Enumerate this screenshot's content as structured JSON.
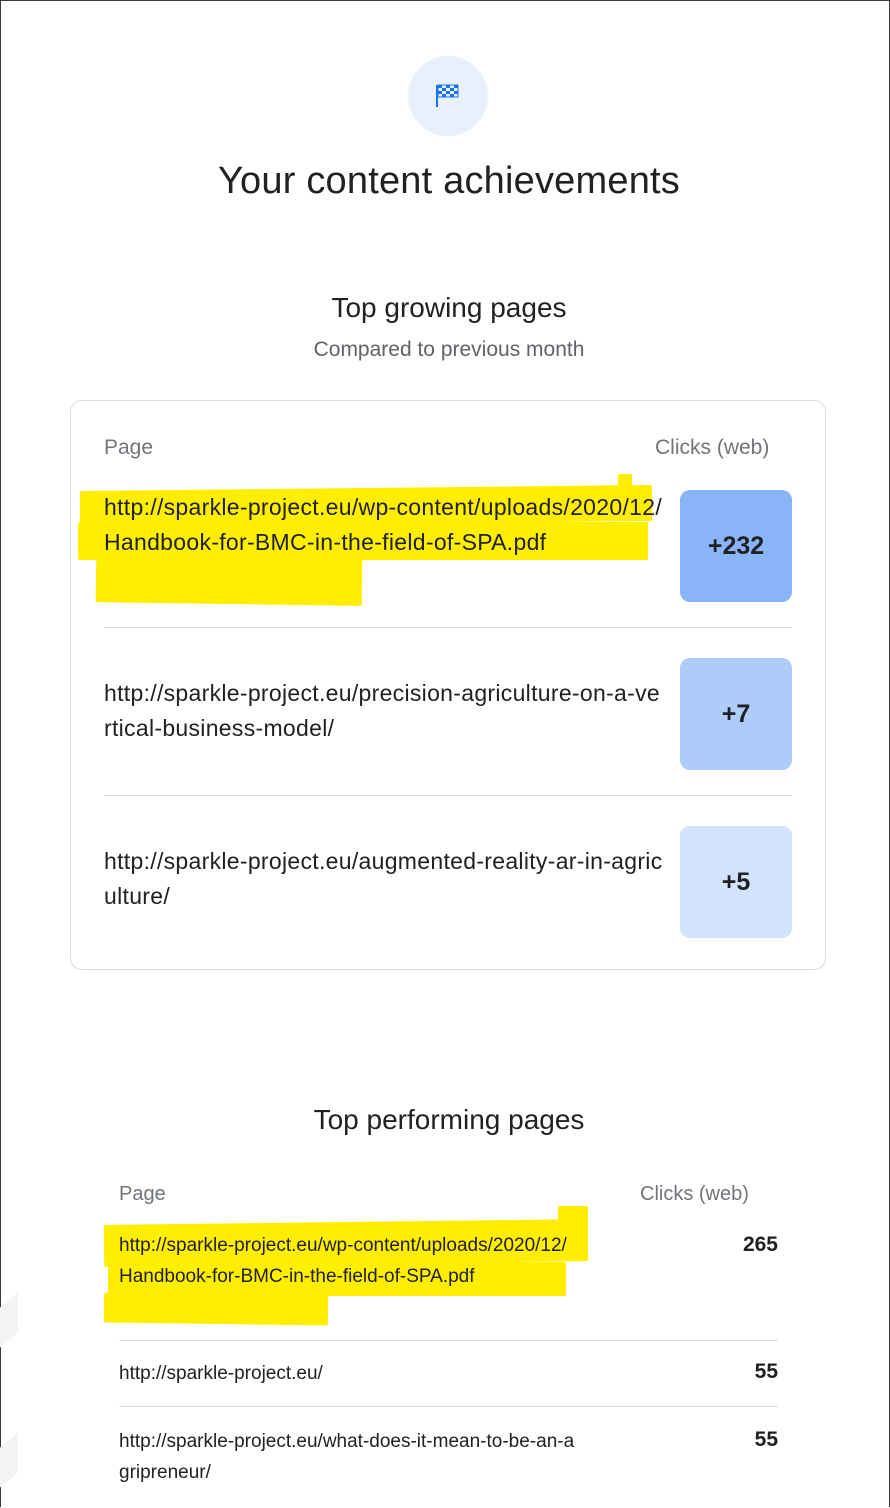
{
  "header": {
    "icon": "checkered-flag-icon",
    "title": "Your content achievements"
  },
  "growing": {
    "title": "Top growing pages",
    "subtitle": "Compared to previous month",
    "col_page": "Page",
    "col_clicks": "Clicks (web)",
    "rows": [
      {
        "url": "http://sparkle-project.eu/wp-content/uploads/2020/12/Handbook-for-BMC-in-the-field-of-SPA.pdf",
        "value": "+232",
        "highlighted": true,
        "badge_color": "#8ab4f8"
      },
      {
        "url": "http://sparkle-project.eu/precision-agriculture-on-a-vertical-business-model/",
        "value": "+7",
        "highlighted": false,
        "badge_color": "#aecbfa"
      },
      {
        "url": "http://sparkle-project.eu/augmented-reality-ar-in-agriculture/",
        "value": "+5",
        "highlighted": false,
        "badge_color": "#d2e3fc"
      }
    ]
  },
  "performing": {
    "title": "Top performing pages",
    "col_page": "Page",
    "col_clicks": "Clicks (web)",
    "rows": [
      {
        "url": "http://sparkle-project.eu/wp-content/uploads/2020/12/Handbook-for-BMC-in-the-field-of-SPA.pdf",
        "value": "265",
        "highlighted": true
      },
      {
        "url": "http://sparkle-project.eu/",
        "value": "55",
        "highlighted": false
      },
      {
        "url": "http://sparkle-project.eu/what-does-it-mean-to-be-an-agripreneur/",
        "value": "55",
        "highlighted": false
      }
    ]
  },
  "colors": {
    "highlight": "#ffee00",
    "accent_blue": "#8ab4f8"
  }
}
